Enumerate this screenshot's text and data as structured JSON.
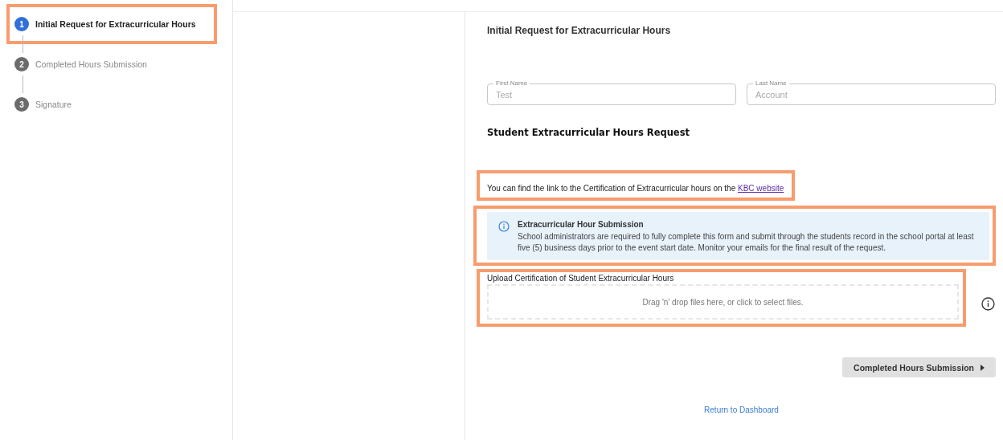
{
  "steps": [
    {
      "number": "1",
      "label": "Initial Request for Extracurricular Hours",
      "selected": true,
      "highlighted": true
    },
    {
      "number": "2",
      "label": "Completed Hours Submission",
      "selected": false,
      "highlighted": false
    },
    {
      "number": "3",
      "label": "Signature",
      "selected": false,
      "highlighted": false
    }
  ],
  "form": {
    "title": "Initial Request for Extracurricular Hours",
    "fields": [
      {
        "label": "First Name",
        "placeholder": "Test"
      },
      {
        "label": "Last Name",
        "placeholder": "Account"
      }
    ],
    "section_heading": "Student Extracurricular Hours Request",
    "link_note": {
      "text": "You can find the link to the Certification of Extracurricular hours on the",
      "link": "KBC website",
      "highlighted": true
    },
    "alert": {
      "title": "Extracurricular Hour Submission",
      "body": "School administrators are required to fully complete this form and submit through the students record in the school portal at least five (5) business days prior to the event start date. Monitor your emails for the final result of the request.",
      "highlighted": true
    },
    "upload": {
      "label": "Upload Certification of Student Extracurricular Hours",
      "hint": "Drag 'n' drop files here, or click to select files.",
      "highlighted": true
    },
    "next_button": {
      "label": "Completed Hours Submission"
    },
    "return_link": "Return to Dashboard"
  }
}
